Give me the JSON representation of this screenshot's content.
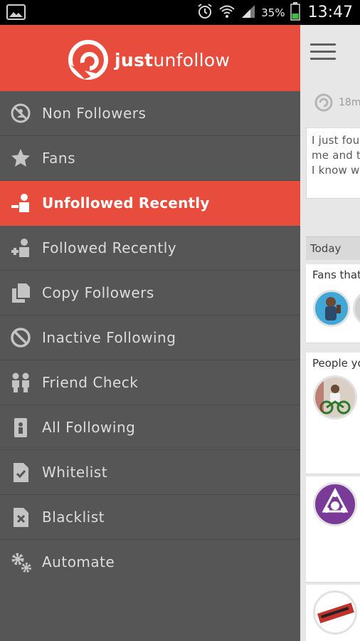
{
  "status_bar": {
    "battery_percent": "35%",
    "time": "13:47"
  },
  "drawer": {
    "brand": {
      "part1": "just",
      "part2": "unfollow"
    },
    "items": [
      {
        "label": "Non Followers",
        "icon": "no-follow-icon",
        "active": false
      },
      {
        "label": "Fans",
        "icon": "star-icon",
        "active": false
      },
      {
        "label": "Unfollowed Recently",
        "icon": "unfollow-person-icon",
        "active": true
      },
      {
        "label": "Followed Recently",
        "icon": "follow-person-icon",
        "active": false
      },
      {
        "label": "Copy Followers",
        "icon": "copy-icon",
        "active": false
      },
      {
        "label": "Inactive Following",
        "icon": "inactive-icon",
        "active": false
      },
      {
        "label": "Friend Check",
        "icon": "friends-icon",
        "active": false
      },
      {
        "label": "All Following",
        "icon": "id-badge-icon",
        "active": false
      },
      {
        "label": "Whitelist",
        "icon": "whitelist-doc-icon",
        "active": false
      },
      {
        "label": "Blacklist",
        "icon": "blacklist-doc-icon",
        "active": false
      },
      {
        "label": "Automate",
        "icon": "gears-icon",
        "active": false
      }
    ]
  },
  "content": {
    "tweet": {
      "time_partial": "18m",
      "lines": [
        "I just fou",
        "me and t",
        "I know w"
      ]
    },
    "section_label": "Today",
    "cards": [
      {
        "title_partial": "Fans that"
      },
      {
        "title_partial": "People yo"
      }
    ]
  },
  "colors": {
    "accent": "#e84c3d",
    "drawer_bg": "#565656",
    "divider": "#4b4b4b",
    "label": "#dcdcdc"
  }
}
